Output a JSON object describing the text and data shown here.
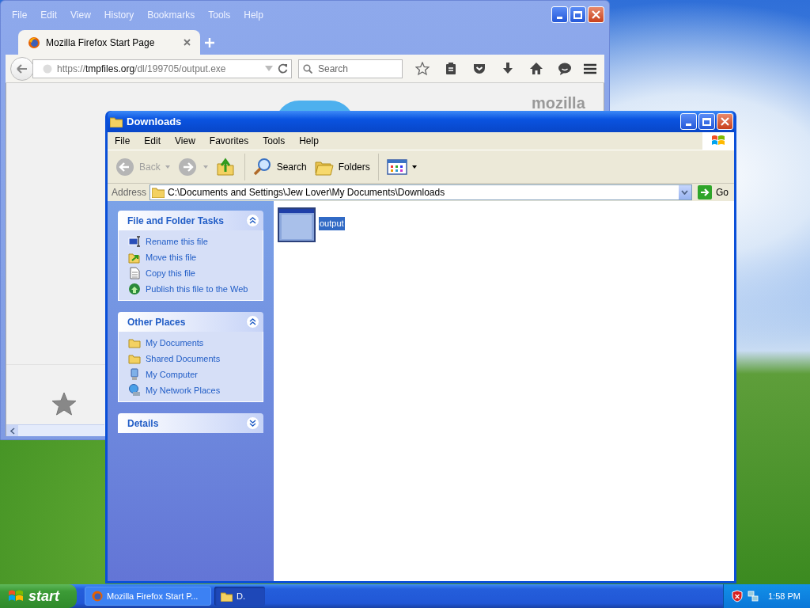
{
  "firefox": {
    "menu": [
      "File",
      "Edit",
      "View",
      "History",
      "Bookmarks",
      "Tools",
      "Help"
    ],
    "tabs": [
      {
        "title": "Mozilla Firefox Start Page",
        "selected": true
      }
    ],
    "url": {
      "scheme": "https://",
      "host": "tmpfiles.org",
      "path": "/dl/199705/output.exe"
    },
    "search": {
      "placeholder": "Search"
    },
    "page": {
      "logo": "mozilla"
    }
  },
  "explorer": {
    "title": "Downloads",
    "menu": [
      "File",
      "Edit",
      "View",
      "Favorites",
      "Tools",
      "Help"
    ],
    "toolbar": [
      {
        "kind": "back",
        "label": "Back",
        "disabled": true
      },
      {
        "kind": "forward",
        "disabled": true
      },
      {
        "kind": "up",
        "disabled": false
      },
      {
        "kind": "search",
        "label": "Search",
        "disabled": false
      },
      {
        "kind": "folders",
        "label": "Folders",
        "disabled": false
      },
      {
        "kind": "views",
        "disabled": false
      }
    ],
    "address": {
      "label": "Address",
      "value": "C:\\Documents and Settings\\Jew Lover\\My Documents\\Downloads",
      "go": "Go"
    },
    "panels": [
      {
        "title": "File and Folder Tasks",
        "expanded": true,
        "items": [
          {
            "kind": "rename",
            "label": "Rename this file"
          },
          {
            "kind": "move",
            "label": "Move this file"
          },
          {
            "kind": "copy",
            "label": "Copy this file"
          },
          {
            "kind": "publish",
            "label": "Publish this file to the Web"
          }
        ]
      },
      {
        "title": "Other Places",
        "expanded": true,
        "items": [
          {
            "kind": "folder",
            "label": "My Documents"
          },
          {
            "kind": "folder",
            "label": "Shared Documents"
          },
          {
            "kind": "computer",
            "label": "My Computer"
          },
          {
            "kind": "network",
            "label": "My Network Places"
          }
        ]
      },
      {
        "title": "Details",
        "expanded": false
      }
    ],
    "files": [
      {
        "name": "output",
        "selected": true
      }
    ]
  },
  "taskbar": {
    "start": "start",
    "tasks": [
      {
        "kind": "firefox",
        "label": "Mozilla Firefox Start P...",
        "selected": false
      },
      {
        "kind": "folder",
        "label": "D.",
        "selected": true
      }
    ],
    "clock": "1:58 PM"
  }
}
